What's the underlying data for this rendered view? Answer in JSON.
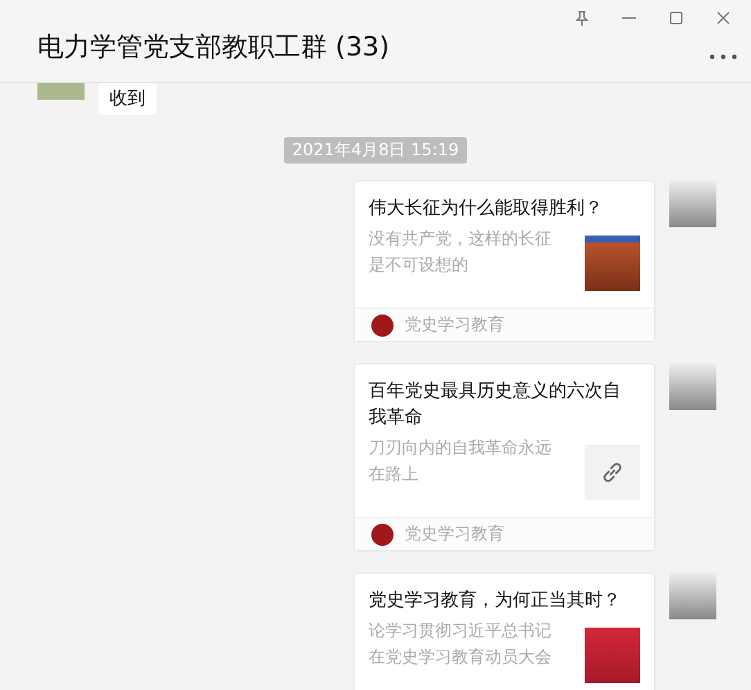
{
  "window": {
    "title": "电力学管党支部教职工群 (33)"
  },
  "messages": [
    {
      "kind": "incoming-text",
      "text": "收到"
    },
    {
      "kind": "time",
      "text": "2021年4月8日 15:19"
    },
    {
      "kind": "outgoing-card",
      "title": "伟大长征为什么能取得胜利？",
      "description": "没有共产党，这样的长征是不可设想的",
      "thumbnail": {
        "kind": "photo"
      },
      "source": "党史学习教育"
    },
    {
      "kind": "outgoing-card",
      "title": "百年党史最具历史意义的六次自我革命",
      "description": "刀刃向内的自我革命永远在路上",
      "thumbnail": {
        "kind": "link"
      },
      "source": "党史学习教育"
    },
    {
      "kind": "outgoing-card",
      "title": "党史学习教育，为何正当其时？",
      "description": "论学习贯彻习近平总书记在党史学习教育动员大会",
      "thumbnail": {
        "kind": "poster"
      }
    }
  ]
}
